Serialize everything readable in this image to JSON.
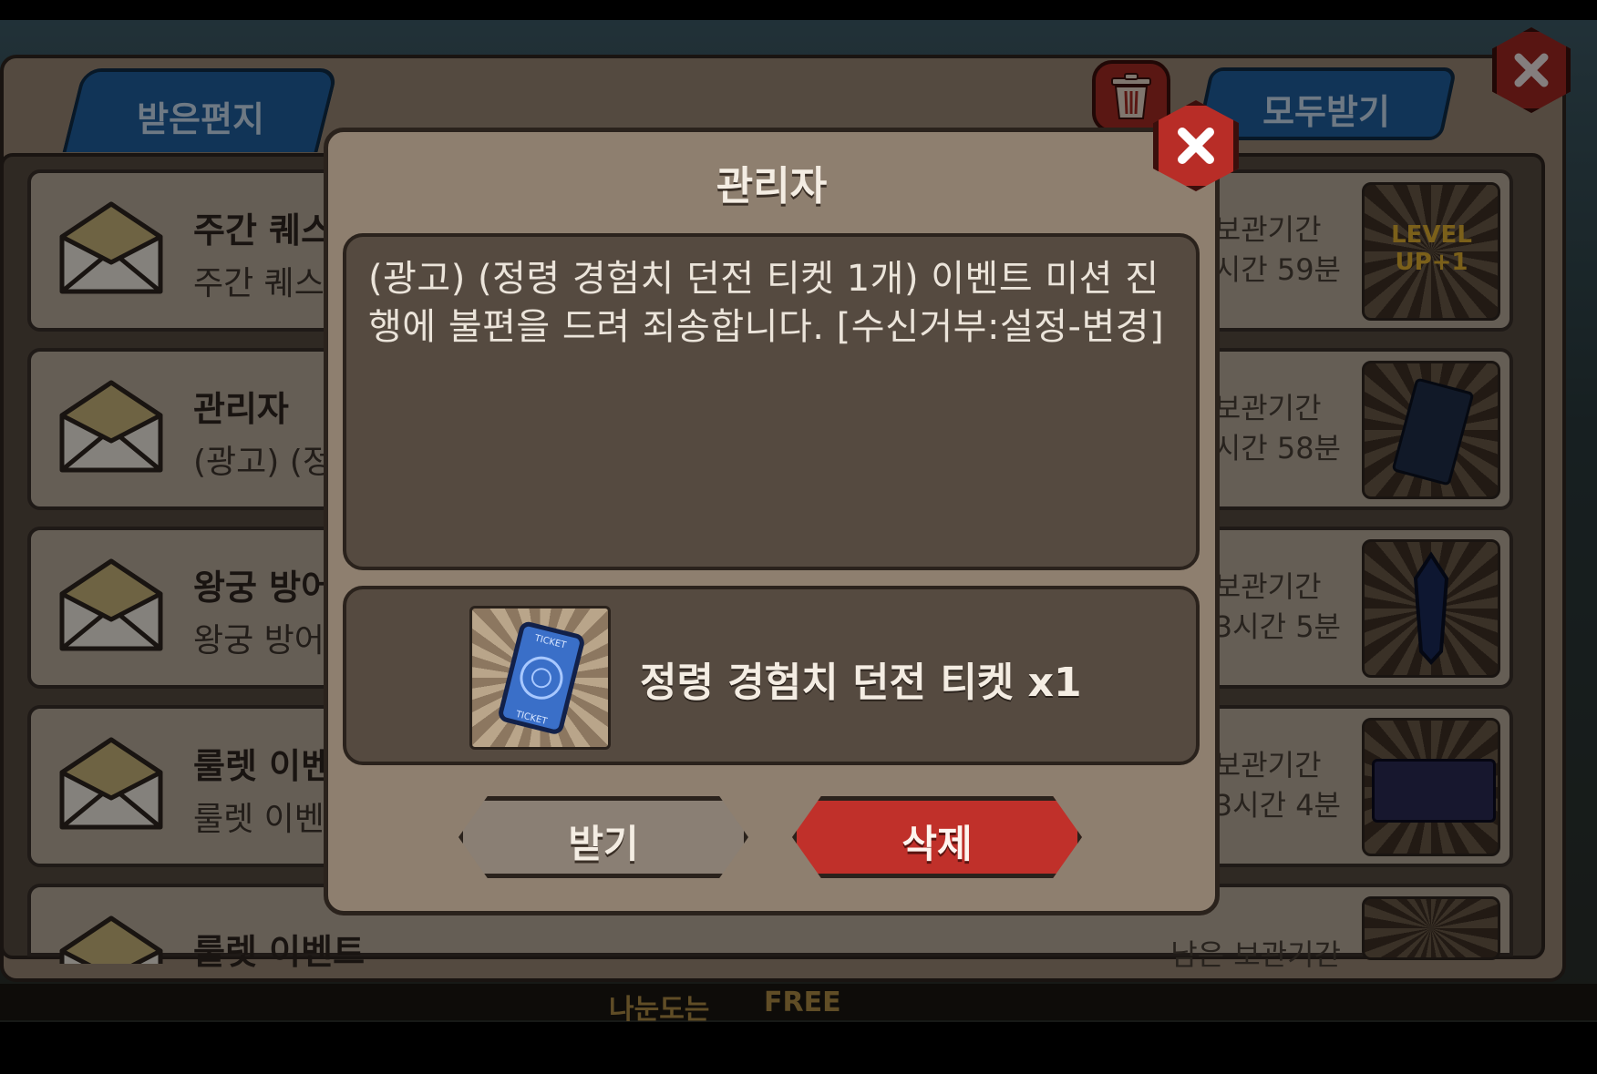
{
  "mailbox": {
    "tab_received": "받은편지",
    "receive_all": "모두받기",
    "rows": [
      {
        "title": "주간 퀘스",
        "subtitle": "주간 퀘스",
        "expire_line1": "보관기간",
        "expire_line2": "시간 59분"
      },
      {
        "title": "관리자",
        "subtitle": "(광고) (정",
        "expire_line1": "보관기간",
        "expire_line2": "시간 58분"
      },
      {
        "title": "왕궁 방어",
        "subtitle": "왕궁 방어",
        "expire_line1": "보관기간",
        "expire_line2": "3시간 5분"
      },
      {
        "title": "룰렛 이벤",
        "subtitle": "룰렛 이벤",
        "expire_line1": "보관기간",
        "expire_line2": "3시간 4분"
      },
      {
        "title": "룰렛 이벤트",
        "subtitle": "",
        "expire_line1": "남은 보관기간",
        "expire_line2": ""
      }
    ],
    "thumb_text_level": "LEVEL UP+1"
  },
  "dialog": {
    "title": "관리자",
    "message": "(광고) (정령 경험치 던전 티켓 1개) 이벤트 미션 진행에 불편을 드려 죄송합니다. [수신거부:설정-변경]",
    "reward_label": "정령 경험치 던전 티켓 x1",
    "receive_button": "받기",
    "delete_button": "삭제"
  },
  "bottom_bar": {
    "text_left": "나눈도는",
    "text_free": "FREE"
  },
  "colors": {
    "tab_blue": "#1f5f9e",
    "delete_red": "#c0302a",
    "panel_brown": "#8e7f6f"
  }
}
